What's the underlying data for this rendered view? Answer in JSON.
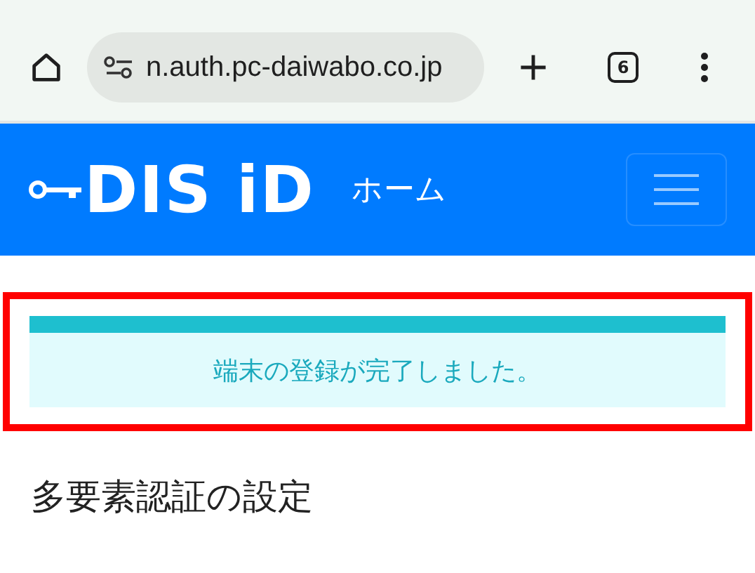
{
  "browser": {
    "url": "n.auth.pc-daiwabo.co.jp",
    "tab_count": "6"
  },
  "header": {
    "logo": "DIS iD",
    "title": "ホーム"
  },
  "alert": {
    "message": "端末の登録が完了しました。",
    "highlighted": true
  },
  "heading": "多要素認証の設定"
}
